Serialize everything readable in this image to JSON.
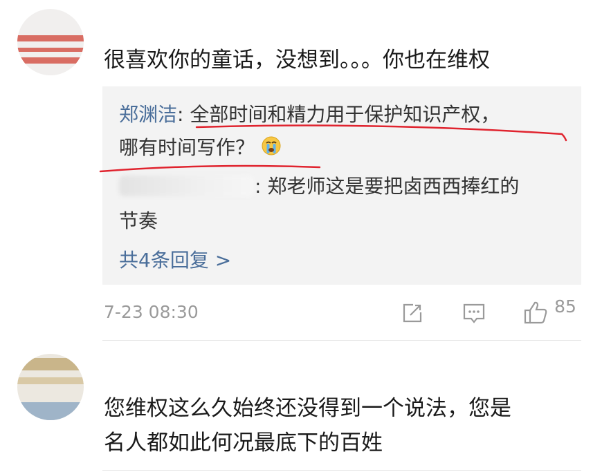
{
  "comments": [
    {
      "username": "",
      "text": "很喜欢你的童话，没想到。。。你也在维权",
      "replies": [
        {
          "author": "郑渊洁",
          "sep": ": ",
          "text_line1": "全部时间和精力用于保护知识产权，",
          "text_line2": "哪有时间写作？",
          "emoji": "crying-face"
        },
        {
          "author": "",
          "sep": ": ",
          "text_line1": "郑老师这是要把卤西西捧红的",
          "text_line2": "节奏"
        }
      ],
      "more_replies": "共4条回复 >",
      "timestamp": "7-23 08:30",
      "like_count": "85"
    },
    {
      "username": "",
      "text_line1": "您维权这么久始终还没得到一个说法，您是",
      "text_line2": "名人都如此何况最底下的百姓"
    }
  ],
  "colors": {
    "link": "#4a6e9a",
    "reply_bg": "#f3f3f3",
    "annotation": "#e0232e",
    "meta": "#9a9a9a"
  },
  "icons": [
    "share-icon",
    "comment-icon",
    "thumbs-up-icon"
  ]
}
